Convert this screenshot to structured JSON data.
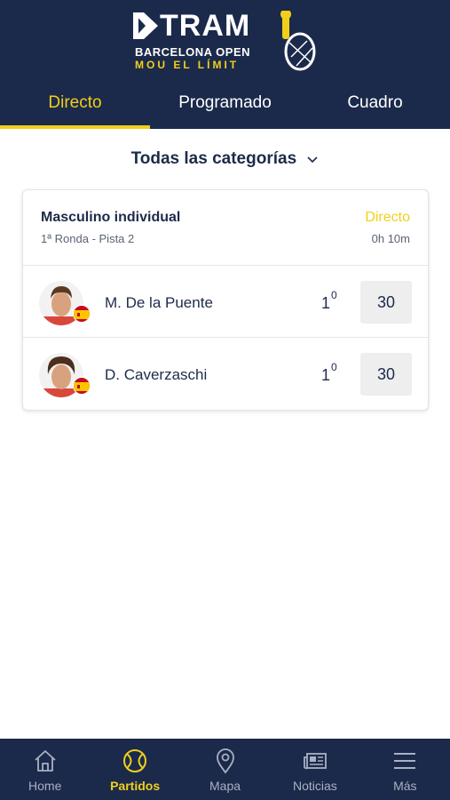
{
  "header": {
    "brand": "TRAM",
    "subtitle": "BARCELONA OPEN",
    "tagline": "MOU EL LÍMIT",
    "tabs": [
      {
        "label": "Directo",
        "active": true
      },
      {
        "label": "Programado",
        "active": false
      },
      {
        "label": "Cuadro",
        "active": false
      }
    ]
  },
  "filter": {
    "category_label": "Todas las categorías"
  },
  "match": {
    "category": "Masculino individual",
    "round": "1ª Ronda -  Pista 2",
    "status": "Directo",
    "duration": "0h 10m",
    "players": [
      {
        "name": "M. De la Puente",
        "set_games": "1",
        "set_sup": "0",
        "points": "30",
        "flag": "spain-flag-icon"
      },
      {
        "name": "D. Caverzaschi",
        "set_games": "1",
        "set_sup": "0",
        "points": "30",
        "flag": "spain-flag-icon"
      }
    ]
  },
  "bottom_nav": [
    {
      "label": "Home",
      "icon": "home-icon",
      "active": false
    },
    {
      "label": "Partidos",
      "icon": "tennis-ball-icon",
      "active": true
    },
    {
      "label": "Mapa",
      "icon": "map-pin-icon",
      "active": false
    },
    {
      "label": "Noticias",
      "icon": "newspaper-icon",
      "active": false
    },
    {
      "label": "Más",
      "icon": "menu-icon",
      "active": false
    }
  ],
  "colors": {
    "navy": "#1b2a4b",
    "accent": "#f1cf1b",
    "score_bg": "#eeeeee"
  }
}
